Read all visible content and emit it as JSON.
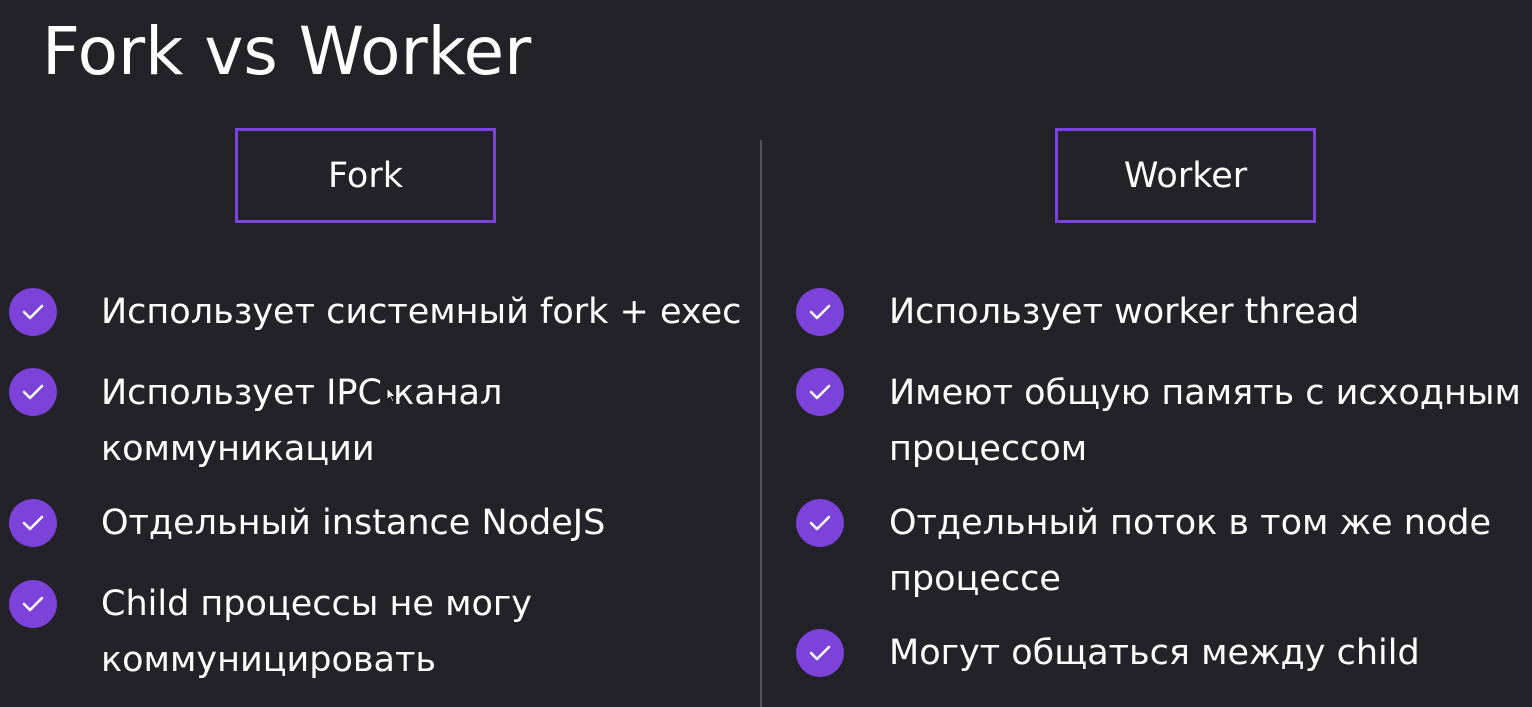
{
  "title": "Fork vs Worker",
  "left_column": {
    "header": "Fork",
    "items": [
      {
        "lines": [
          "Использует системный fork + exec"
        ]
      },
      {
        "lines": [
          "Использует IPC канал",
          "коммуникации"
        ]
      },
      {
        "lines": [
          "Отдельный instance NodeJS"
        ]
      },
      {
        "lines": [
          "Child процессы не могу",
          "коммуницировать"
        ]
      }
    ]
  },
  "right_column": {
    "header": "Worker",
    "items": [
      {
        "lines": [
          "Использует worker thread"
        ]
      },
      {
        "lines": [
          "Имеют общую память с исходным",
          "процессом"
        ]
      },
      {
        "lines": [
          "Отдельный поток в том же node",
          "процессе"
        ]
      },
      {
        "lines": [
          "Могут общаться между child"
        ]
      }
    ]
  },
  "icons": {
    "bullet": "check-circle-icon",
    "cursor": "mouse-pointer-icon"
  },
  "colors": {
    "background": "#232228",
    "accent": "#7c42d9",
    "text": "#ffffff",
    "divider": "#55545a"
  }
}
